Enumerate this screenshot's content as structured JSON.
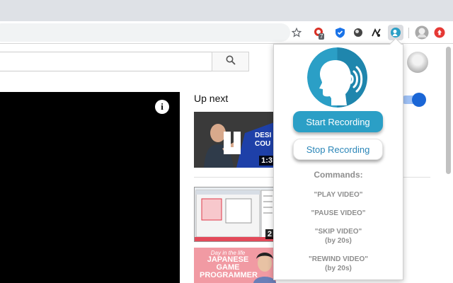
{
  "extension": {
    "start_label": "Start Recording",
    "stop_label": "Stop Recording",
    "commands_title": "Commands:",
    "commands": [
      {
        "line1": "\"PLAY VIDEO\"",
        "line2": ""
      },
      {
        "line1": "\"PAUSE VIDEO\"",
        "line2": ""
      },
      {
        "line1": "\"SKIP VIDEO\"",
        "line2": "(by 20s)"
      },
      {
        "line1": "\"REWIND VIDEO\"",
        "line2": "(by 20s)"
      }
    ],
    "accent_color": "#2b9fc6"
  },
  "browser": {
    "extension_badge": "7",
    "icons": [
      "star-icon",
      "extension-icon-red",
      "shield-icon",
      "extension-icon-ball",
      "extension-icon-drawing",
      "voice-extension-icon",
      "profile-avatar-icon",
      "alert-icon"
    ]
  },
  "youtube": {
    "up_next_label": "Up next",
    "info_label": "i",
    "autoplay_on": true,
    "videos": [
      {
        "duration": "1:3",
        "thumb_text": "DESI COU"
      },
      {
        "duration": "2",
        "thumb_text": ""
      },
      {
        "duration": "",
        "thumb_line1": "Day in the life",
        "thumb_line2": "JAPANESE",
        "thumb_line3": "GAME",
        "thumb_line4": "PROGRAMMER"
      }
    ]
  }
}
